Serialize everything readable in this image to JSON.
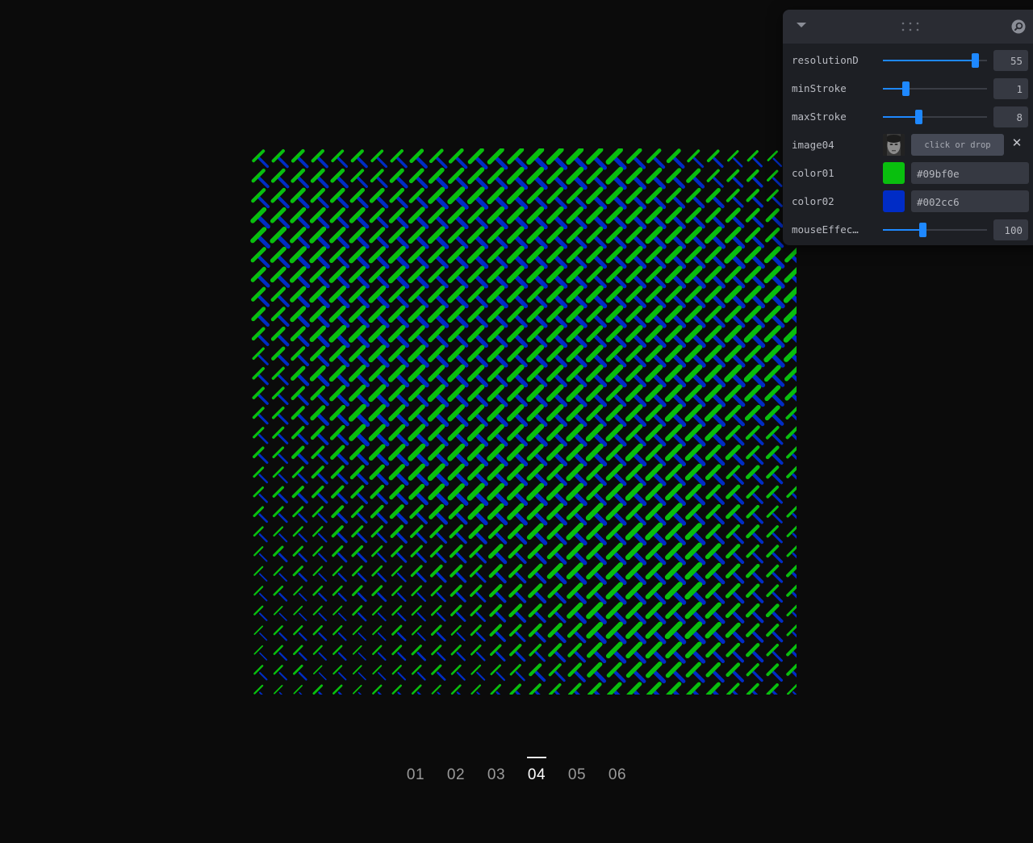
{
  "panel": {
    "header": {
      "collapse_icon": "chevron-down-icon",
      "drag_icon": "drag-handle-icon",
      "search_icon": "search-icon"
    },
    "controls": [
      {
        "label": "resolutionD",
        "value": "55",
        "level": 0.88
      },
      {
        "label": "minStroke",
        "value": "1",
        "level": 0.22
      },
      {
        "label": "maxStroke",
        "value": "8",
        "level": 0.34
      },
      {
        "label": "image04",
        "button": "click or drop",
        "clear_icon": "close-icon"
      },
      {
        "label": "color01",
        "value": "#09bf0e"
      },
      {
        "label": "color02",
        "value": "#002cc6"
      },
      {
        "label": "mouseEffec…",
        "value": "100",
        "level": 0.38
      }
    ]
  },
  "pager": {
    "items": [
      "01",
      "02",
      "03",
      "04",
      "05",
      "06"
    ],
    "active": "04"
  },
  "colors": {
    "background": "#0b0b0b",
    "accent": "#1e88ff",
    "color01": "#09bf0e",
    "color02": "#002cc6"
  }
}
